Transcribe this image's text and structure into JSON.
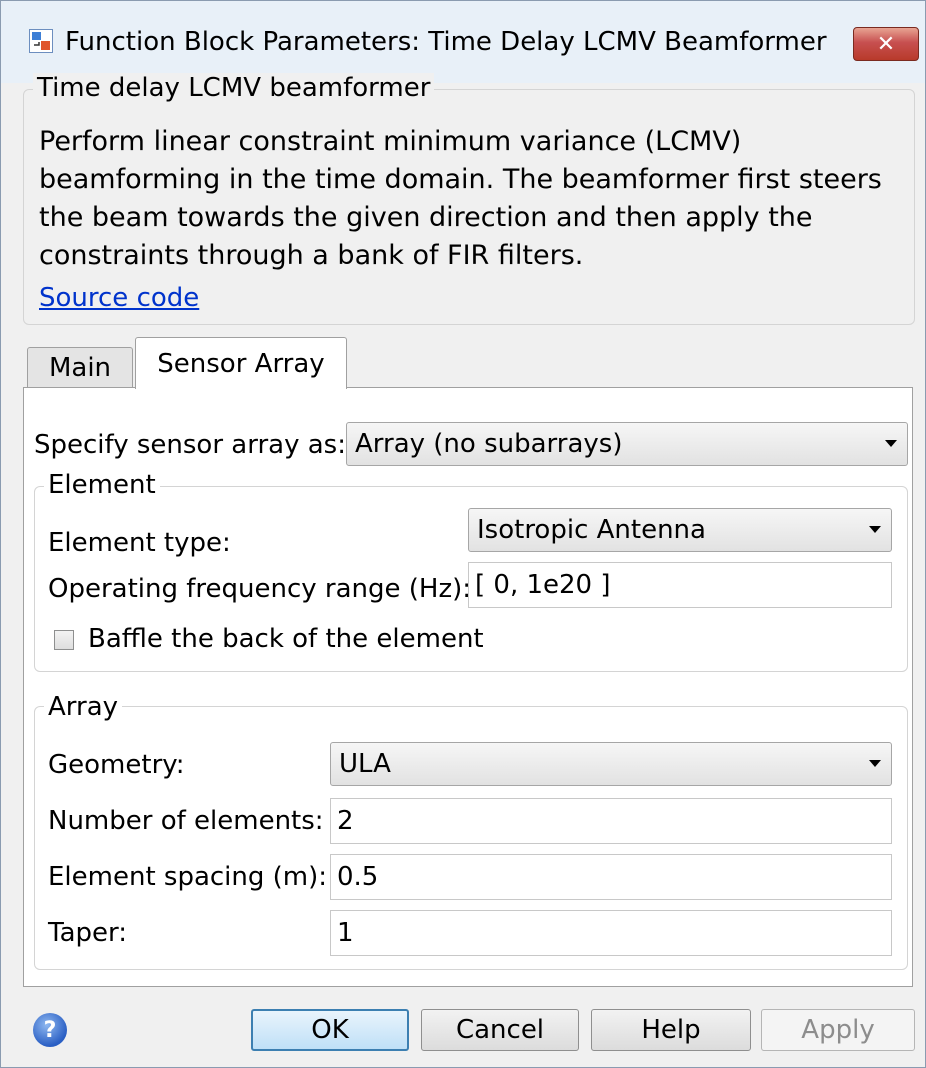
{
  "window": {
    "title": "Function Block Parameters: Time Delay LCMV Beamformer",
    "close_label": "✕"
  },
  "block": {
    "group_label": "Time delay LCMV beamformer",
    "description": "Perform linear constraint minimum variance (LCMV) beamforming in the time domain. The beamformer first steers the beam towards the given direction and then apply the constraints through a bank of FIR filters.",
    "source_link": "Source code"
  },
  "tabs": [
    {
      "label": "Main",
      "active": false
    },
    {
      "label": "Sensor Array",
      "active": true
    }
  ],
  "sensor": {
    "specify_label": "Specify sensor array as:",
    "specify_value": "Array (no subarrays)"
  },
  "element": {
    "group_label": "Element",
    "type_label": "Element type:",
    "type_value": "Isotropic Antenna",
    "freq_label": "Operating frequency range (Hz):",
    "freq_value": "[ 0, 1e20 ]",
    "baffle_label": "Baffle the back of the element",
    "baffle_checked": false
  },
  "array": {
    "group_label": "Array",
    "geometry_label": "Geometry:",
    "geometry_value": "ULA",
    "num_label": "Number of elements:",
    "num_value": "2",
    "spacing_label": "Element spacing (m):",
    "spacing_value": "0.5",
    "taper_label": "Taper:",
    "taper_value": "1"
  },
  "buttons": {
    "help_icon": "?",
    "ok": "OK",
    "cancel": "Cancel",
    "help": "Help",
    "apply": "Apply"
  },
  "colors": {
    "link": "#0033cc",
    "close_button": "#c75050",
    "default_button_border": "#3c7fb1"
  }
}
